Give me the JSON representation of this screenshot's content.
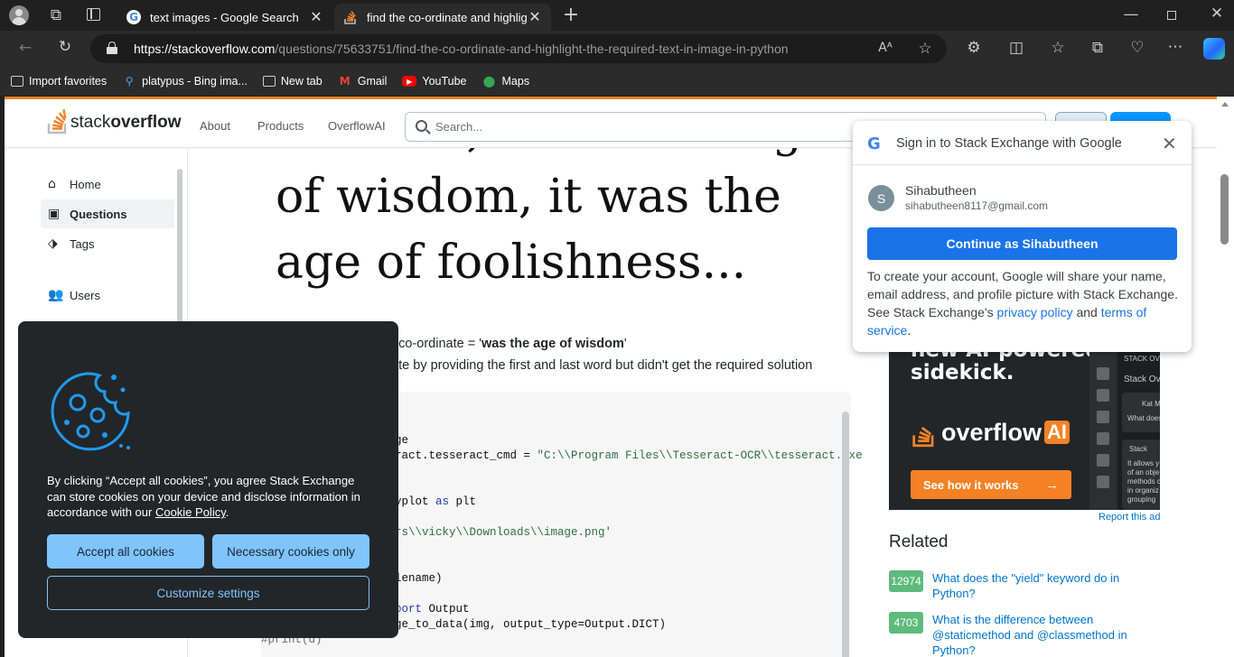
{
  "browser": {
    "tabs": [
      {
        "title": "text images - Google Search",
        "active": false
      },
      {
        "title": "find the co-ordinate and highlight",
        "active": true
      }
    ],
    "url_host": "https://stackoverflow.com",
    "url_path": "/questions/75633751/find-the-co-ordinate-and-highlight-the-required-text-in-image-in-python",
    "favorites": [
      "Import favorites",
      "platypus - Bing ima...",
      "New tab",
      "Gmail",
      "YouTube",
      "Maps"
    ]
  },
  "so": {
    "logo_light": "stack",
    "logo_bold": "overflow",
    "nav": [
      "About",
      "Products",
      "OverflowAI"
    ],
    "search_placeholder": "Search...",
    "leftnav": [
      "Home",
      "Questions",
      "Tags",
      "Users"
    ],
    "image_text": [
      "of times, it was the age",
      "of wisdom, it was the",
      "age of foolishness..."
    ],
    "target_prefix": "et co-ordinate = '",
    "target_bold": "was the age of wisdom",
    "target_suffix": "'",
    "tried_line": "nate by providing the first and last word but didn't get the required solution",
    "code": {
      "l1": "ge",
      "l2a": "ract.tesseract_cmd = ",
      "l2b": "\"C:\\\\Program Files\\\\Tesseract-OCR\\\\tesseract.exe",
      "l3a": "yplot ",
      "l3b": "as",
      "l3c": " plt",
      "l4": "rs\\\\vicky\\\\Downloads\\\\image.png'",
      "l5": "lename)",
      "l6a": "port",
      "l6b": " Output",
      "l7": "ge_to_data(img, output_type=Output.DICT)",
      "l8": "#print(d)"
    },
    "ad": {
      "line1": "new AI-powered",
      "line2": "sidekick.",
      "brand_a": "overflow",
      "brand_b": "AI",
      "cta": "See how it works",
      "report": "Report this ad",
      "panel_title": "STACK OVE",
      "panel_sub": "Stack Ov",
      "panel_user": "Kat M",
      "panel_q": "What does",
      "panel_a": "It allows y of an obje methods c in organiz grouping",
      "panel_b": "Stack"
    },
    "related_title": "Related",
    "related": [
      {
        "count": "12974",
        "title": "What does the \"yield\" keyword do in Python?"
      },
      {
        "count": "4703",
        "title": "What is the difference between @staticmethod and @classmethod in Python?"
      }
    ]
  },
  "cookie": {
    "text_a": "By clicking “Accept all cookies”, you agree Stack Exchange can store cookies on your device and disclose information in accordance with our ",
    "link": "Cookie Policy",
    "text_b": ".",
    "accept": "Accept all cookies",
    "necessary": "Necessary cookies only",
    "customize": "Customize settings"
  },
  "google_popup": {
    "title": "Sign in to Stack Exchange with Google",
    "avatar_letter": "S",
    "name": "Sihabutheen",
    "email": "sihabutheen8117@gmail.com",
    "continue": "Continue as Sihabutheen",
    "text_a": "To create your account, Google will share your name, email address, and profile picture with Stack Exchange. See Stack Exchange's ",
    "privacy": "privacy policy",
    "and": " and ",
    "terms": "terms of service",
    "dot": "."
  },
  "colors": {
    "so_orange": "#f48225",
    "so_blue": "#0a95ff",
    "google_blue": "#1a73e8",
    "cookie_btn": "#7fc4fd",
    "related_green": "#5eba7d"
  }
}
